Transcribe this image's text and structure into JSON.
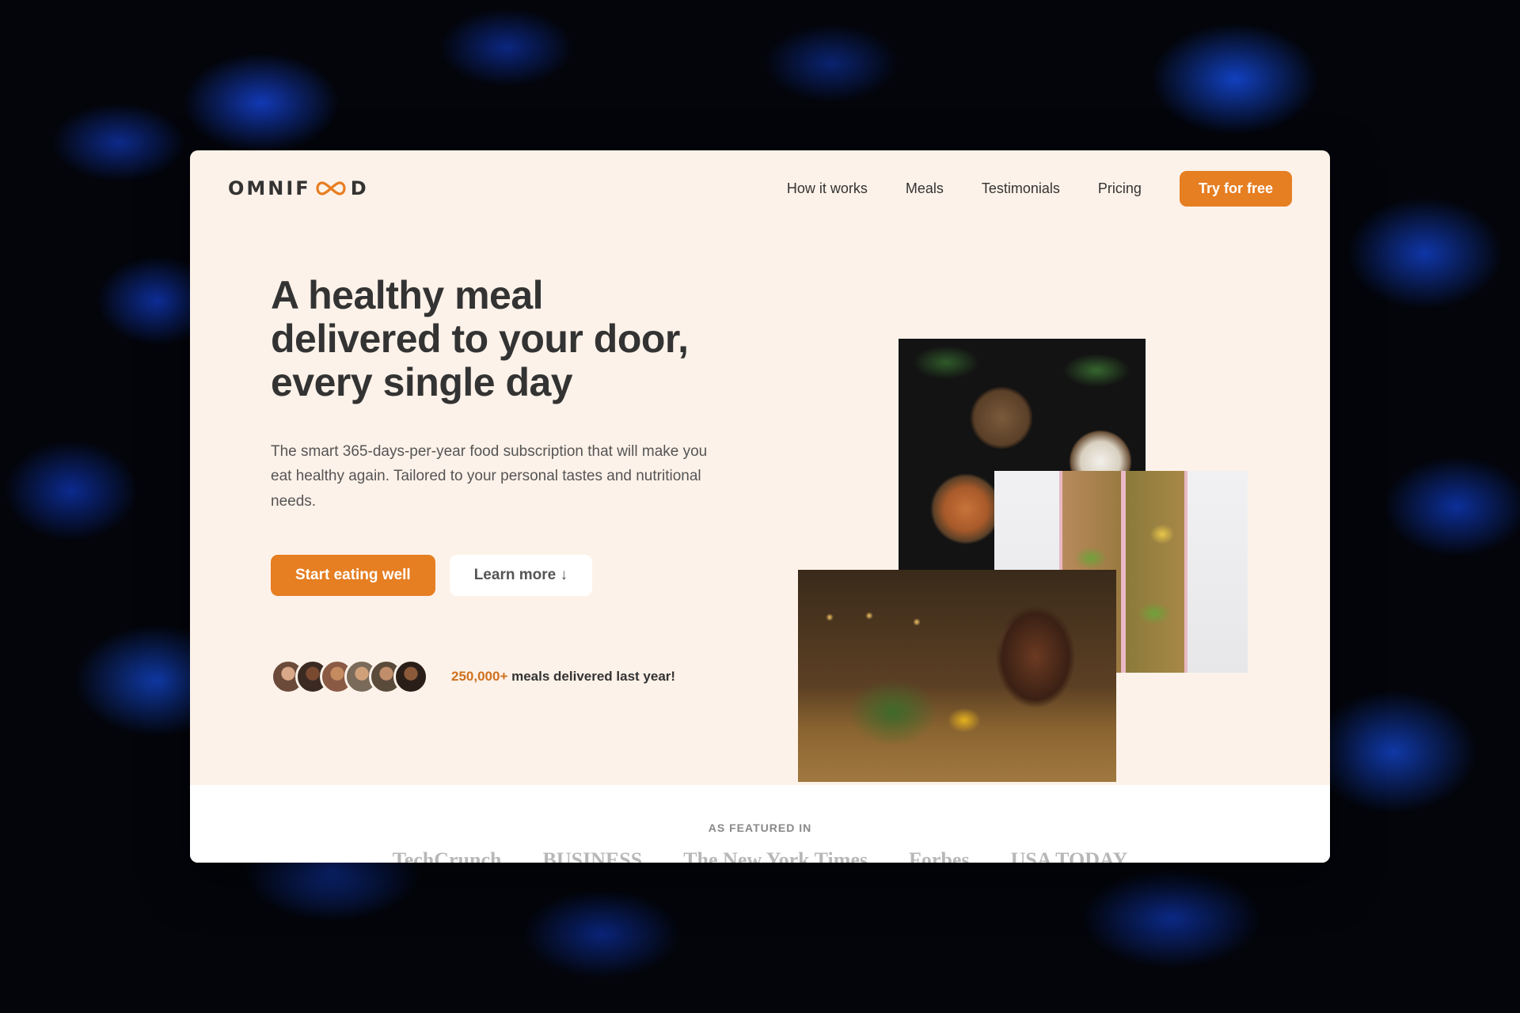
{
  "brand": {
    "logo_text_left": "OMNIF",
    "logo_text_right": "D",
    "accent": "#e67e22",
    "background": "#fdf2e9"
  },
  "nav": {
    "items": [
      {
        "label": "How it works"
      },
      {
        "label": "Meals"
      },
      {
        "label": "Testimonials"
      },
      {
        "label": "Pricing"
      }
    ],
    "cta_label": "Try for free"
  },
  "hero": {
    "title_line1": "A healthy meal",
    "title_line2": "delivered to your door,",
    "title_line3": "every single day",
    "description": "The smart 365-days-per-year food subscription that will make you eat healthy again. Tailored to your personal tastes and nutritional needs.",
    "primary_button": "Start eating well",
    "secondary_button": "Learn more ↓",
    "delivered_count": "250,000+",
    "delivered_text": " meals delivered last year!",
    "avatar_colors": [
      "#6b4a3a",
      "#3a2a22",
      "#8a5a44",
      "#7a6a5a",
      "#5a4a3a",
      "#2a1e18"
    ]
  },
  "featured": {
    "label": "AS FEATURED IN",
    "logos": [
      "TechCrunch",
      "BUSINESS",
      "The New York Times",
      "Forbes",
      "USA TODAY"
    ]
  }
}
